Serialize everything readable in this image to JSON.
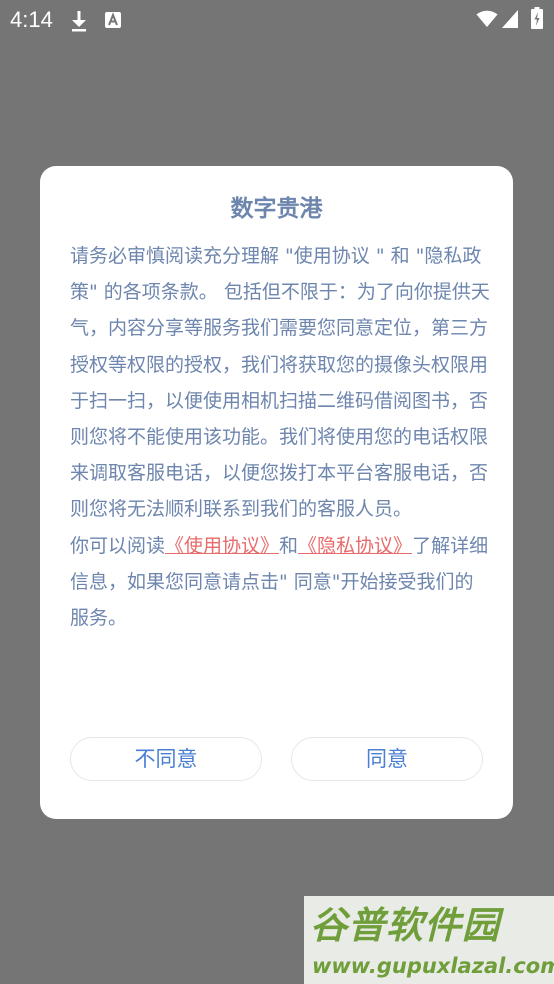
{
  "status_bar": {
    "time": "4:14",
    "icons": [
      "download-icon",
      "accessibility-icon",
      "wifi-icon",
      "signal-icon",
      "battery-icon"
    ]
  },
  "dialog": {
    "title": "数字贵港",
    "paragraph1": "请务必审慎阅读充分理解 \"使用协议 \" 和 \"隐私政策\" 的各项条款。 包括但不限于：为了向你提供天气，内容分享等服务我们需要您同意定位，第三方授权等权限的授权，我们将获取您的摄像头权限用于扫一扫，以便使用相机扫描二维码借阅图书，否则您将不能使用该功能。我们将使用您的电话权限来调取客服电话，以便您拨打本平台客服电话，否则您将无法顺利联系到我们的客服人员。",
    "paragraph2": {
      "prefix": "你可以阅读",
      "link_usage": "《使用协议》",
      "middle": "和",
      "link_privacy": "《隐私协议》",
      "suffix": "了解详细信息，如果您同意请点击\" 同意\"开始接受我们的服务。"
    },
    "disagree_label": "不同意",
    "agree_label": "同意"
  },
  "watermark": {
    "logo_text": "谷普软件园",
    "url": "www.gupuxlazal.com"
  },
  "colors": {
    "overlay": "#757575",
    "title_text": "#6E86AE",
    "link": "#E86A6A",
    "button_text": "#4A7FD4",
    "watermark_green": "#6F9E3B"
  }
}
